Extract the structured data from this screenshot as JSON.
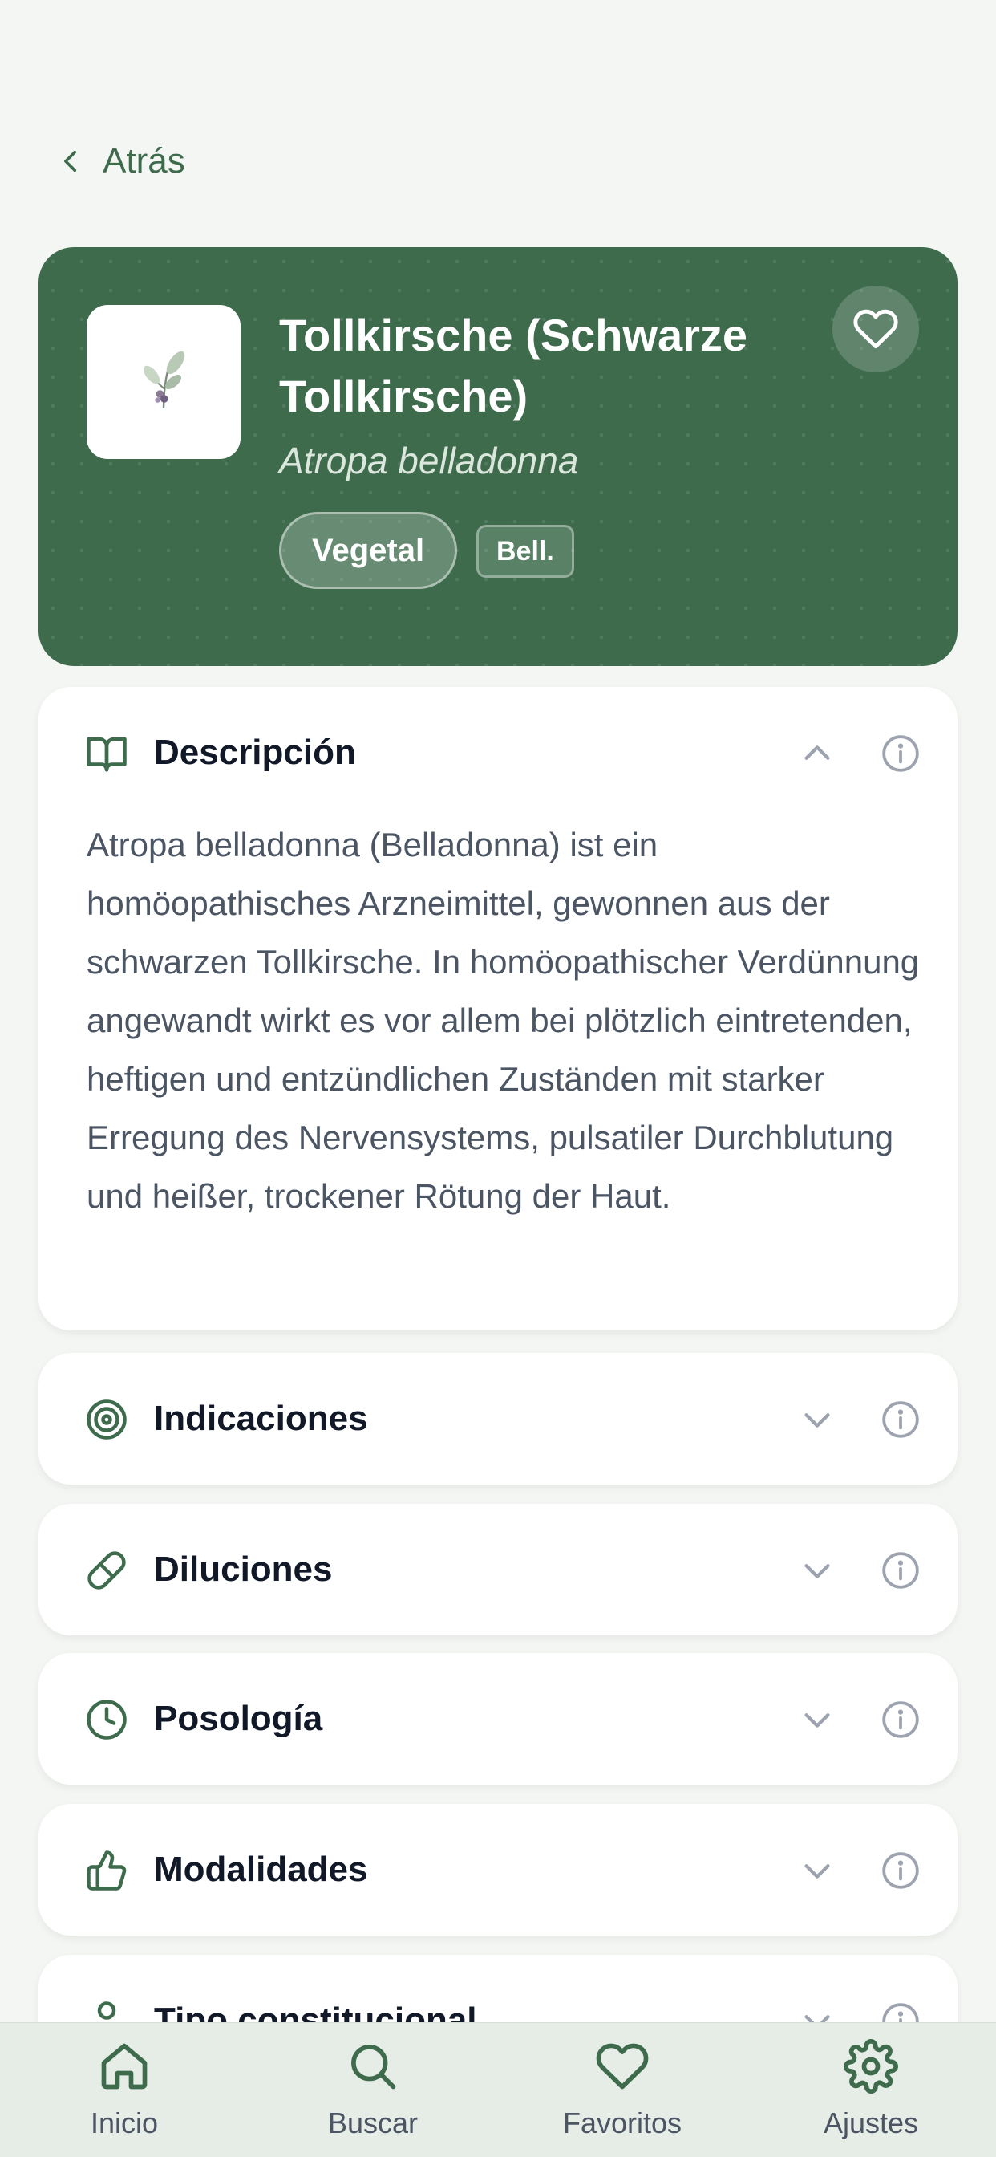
{
  "nav": {
    "back_label": "Atrás"
  },
  "remedy": {
    "title": "Tollkirsche (Schwarze Tollkirsche)",
    "latin_name": "Atropa belladonna",
    "kingdom_tag": "Vegetal",
    "abbreviation": "Bell.",
    "favorite_icon": "heart-outline-icon",
    "image_icon": "plant-illustration"
  },
  "sections": [
    {
      "title": "Descripción",
      "icon": "book-icon",
      "expanded": true,
      "body": "Atropa belladonna (Belladonna) ist ein homöopathisches Arzneimittel, gewonnen aus der schwarzen Tollkirsche. In homöopathischer Verdünnung angewandt wirkt es vor allem bei plötzlich eintretenden, heftigen und entzündlichen Zuständen mit starker Erregung des Nervensystems, pulsatiler Durchblutung und heißer, trockener Rötung der Haut."
    },
    {
      "title": "Indicaciones",
      "icon": "target-icon",
      "expanded": false
    },
    {
      "title": "Diluciones",
      "icon": "pill-icon",
      "expanded": false
    },
    {
      "title": "Posología",
      "icon": "clock-icon",
      "expanded": false
    },
    {
      "title": "Modalidades",
      "icon": "thumbs-up-icon",
      "expanded": false
    },
    {
      "title": "Tipo constitucional",
      "icon": "person-icon",
      "expanded": false
    }
  ],
  "bottom_nav": [
    {
      "label": "Inicio",
      "icon": "home-icon"
    },
    {
      "label": "Buscar",
      "icon": "search-icon"
    },
    {
      "label": "Favoritos",
      "icon": "heart-icon"
    },
    {
      "label": "Ajustes",
      "icon": "settings-gear-icon"
    }
  ],
  "colors": {
    "brand_green": "#3d6b4c",
    "background": "#f4f6f3",
    "nav_background": "#e6ede6",
    "text_dark": "#111827",
    "text_body": "#4b5563",
    "icon_muted": "#9ca3af"
  }
}
